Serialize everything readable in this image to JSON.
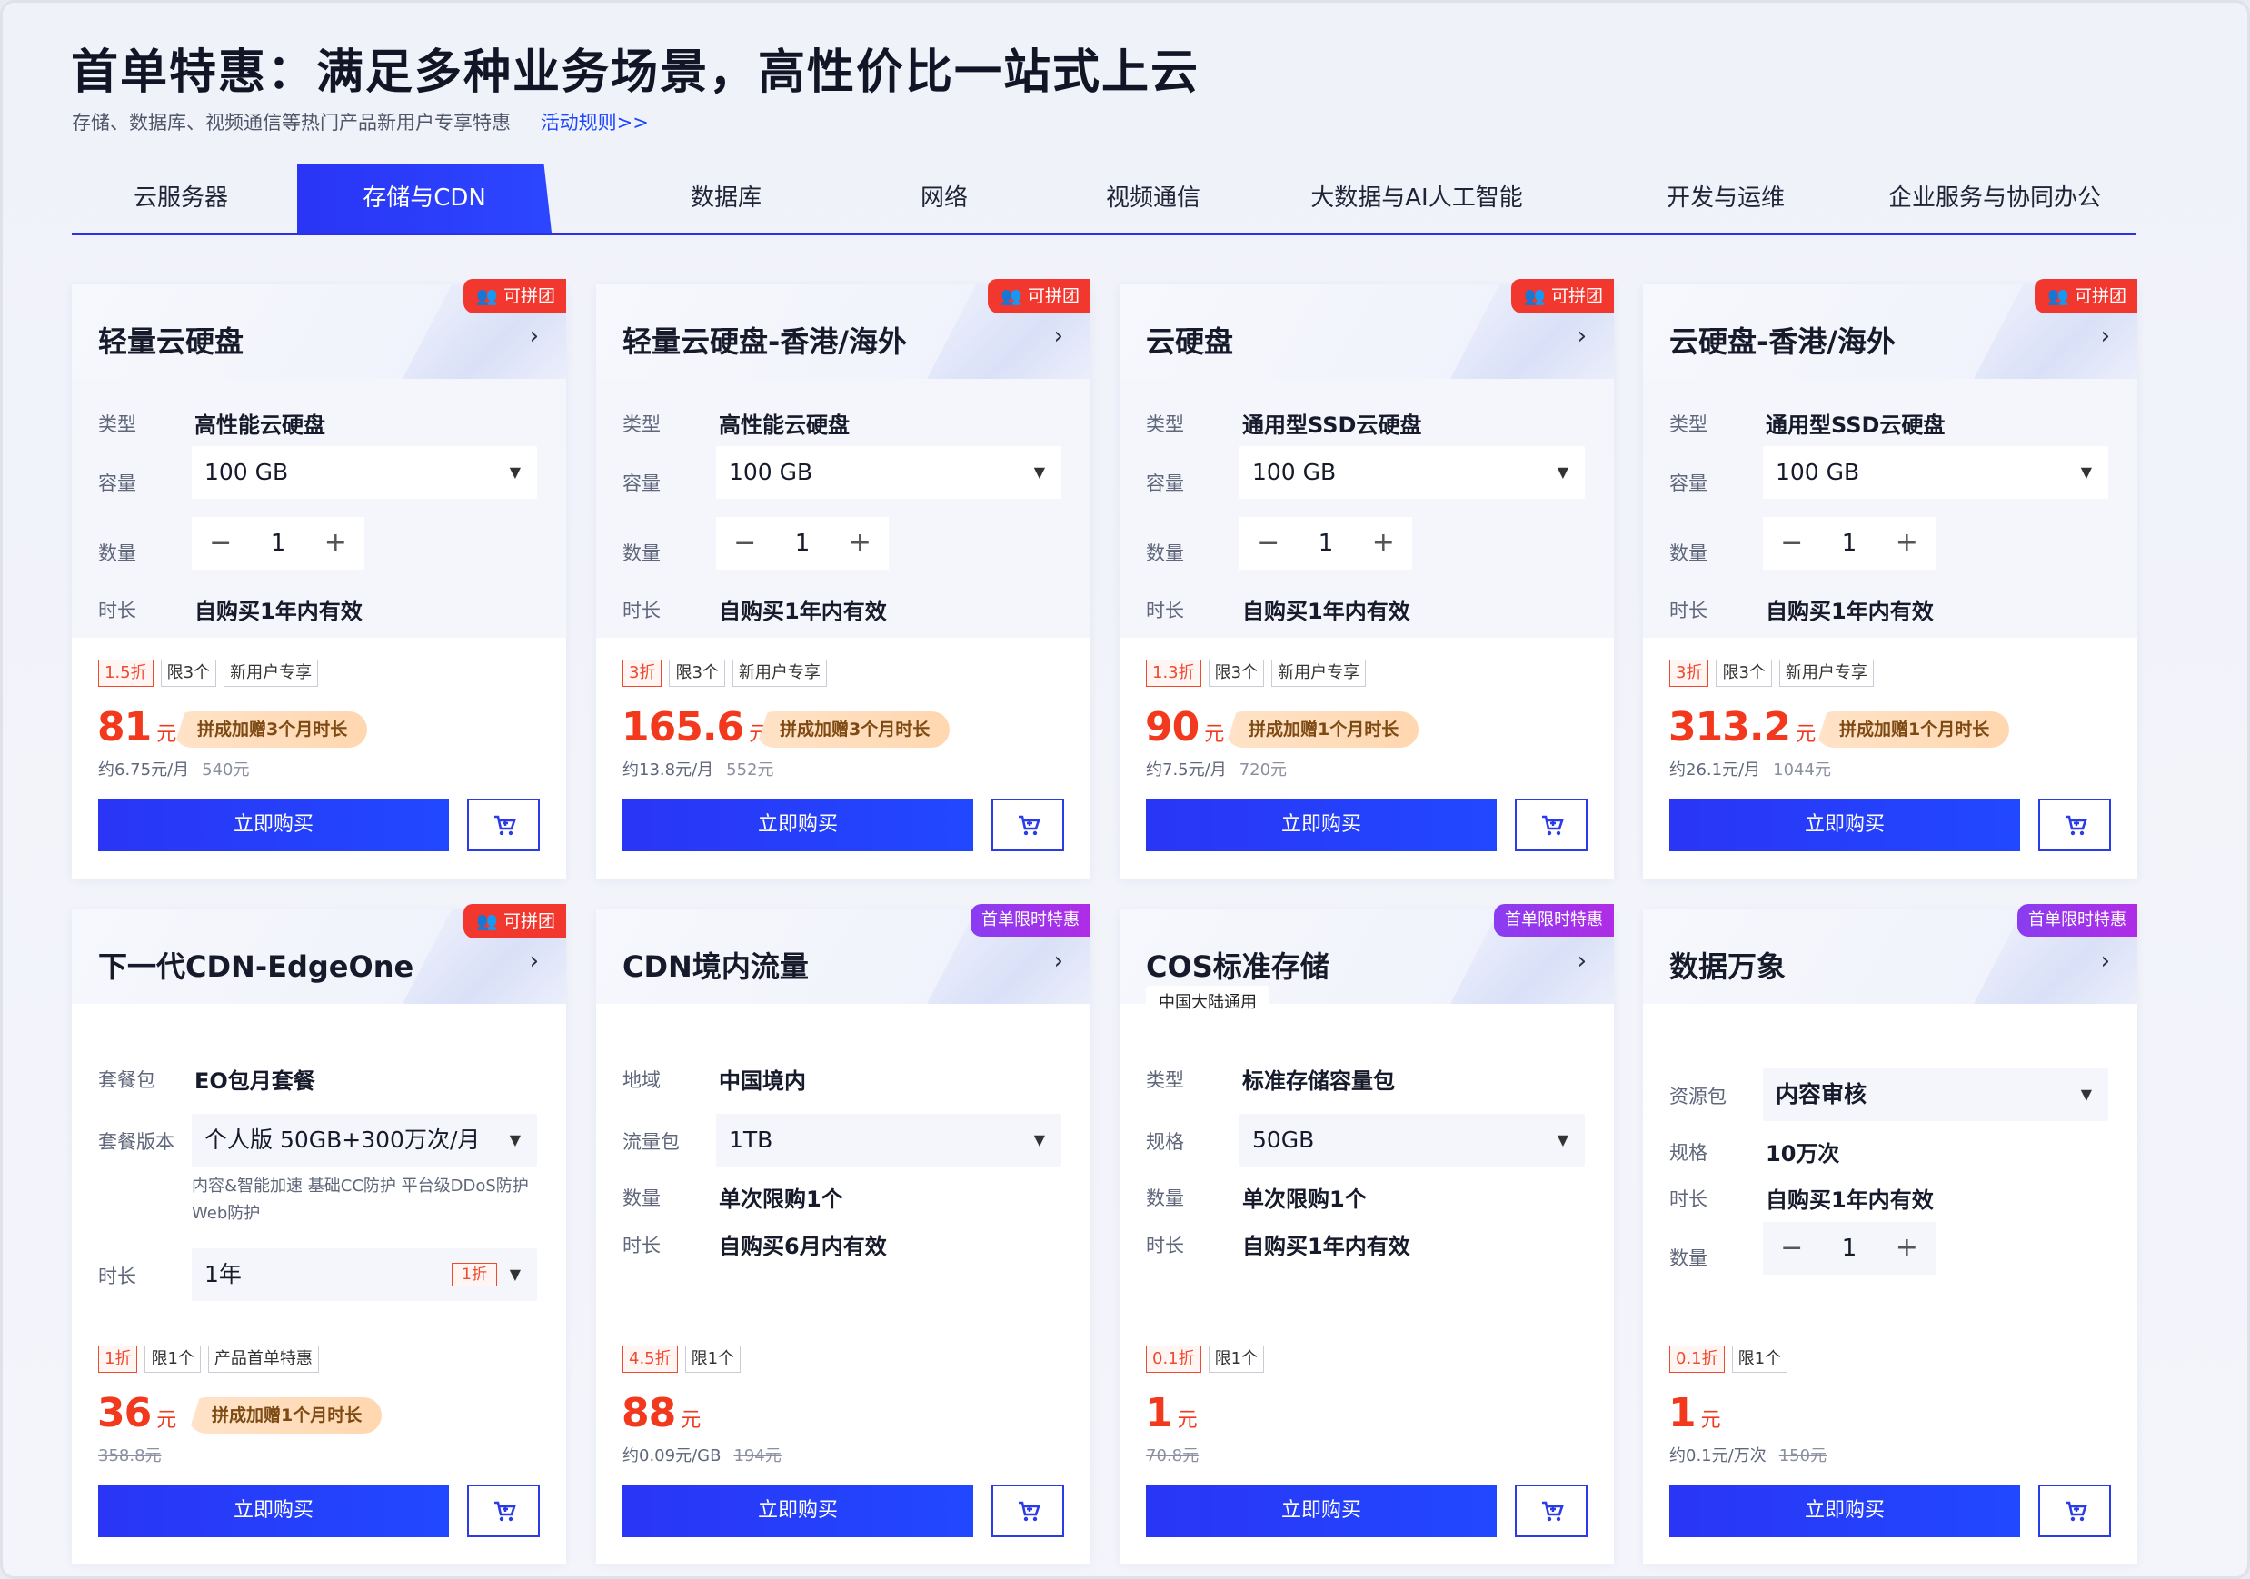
{
  "header": {
    "title": "首单特惠：满足多种业务场景，高性价比一站式上云",
    "subtitle": "存储、数据库、视频通信等热门产品新用户专享特惠",
    "rule_link": "活动规则>>"
  },
  "tabs": [
    {
      "label": "云服务器"
    },
    {
      "label": "存储与CDN",
      "active": true
    },
    {
      "label": "数据库"
    },
    {
      "label": "网络"
    },
    {
      "label": "视频通信"
    },
    {
      "label": "大数据与AI人工智能"
    },
    {
      "label": "开发与运维"
    },
    {
      "label": "企业服务与协同办公"
    }
  ],
  "common": {
    "buy_label": "立即购买",
    "chevron": "›",
    "minus": "−",
    "plus": "+",
    "caret": "▼",
    "group_badge": "可拼团",
    "first_badge": "首单限时特惠",
    "yuan": "元",
    "icons": {
      "cart": "cart-icon",
      "people": "group-icon",
      "chevron": "chevron-right-icon",
      "caret": "caret-down-icon"
    }
  },
  "cards": [
    {
      "name": "轻量云硬盘",
      "badge": "可拼团",
      "specs": {
        "type_label": "类型",
        "type_value": "高性能云硬盘",
        "cap_label": "容量",
        "cap_value": "100 GB",
        "qty_label": "数量",
        "qty_value": "1",
        "dur_label": "时长",
        "dur_value": "自购买1年内有效"
      },
      "tags": [
        "1.5折",
        "限3个",
        "新用户专享"
      ],
      "price": "81",
      "promo": "拼成加赠3个月时长",
      "per": "约6.75元/月",
      "orig": "540元"
    },
    {
      "name": "轻量云硬盘-香港/海外",
      "badge": "可拼团",
      "specs": {
        "type_label": "类型",
        "type_value": "高性能云硬盘",
        "cap_label": "容量",
        "cap_value": "100 GB",
        "qty_label": "数量",
        "qty_value": "1",
        "dur_label": "时长",
        "dur_value": "自购买1年内有效"
      },
      "tags": [
        "3折",
        "限3个",
        "新用户专享"
      ],
      "price": "165.6",
      "promo": "拼成加赠3个月时长",
      "per": "约13.8元/月",
      "orig": "552元"
    },
    {
      "name": "云硬盘",
      "badge": "可拼团",
      "specs": {
        "type_label": "类型",
        "type_value": "通用型SSD云硬盘",
        "cap_label": "容量",
        "cap_value": "100 GB",
        "qty_label": "数量",
        "qty_value": "1",
        "dur_label": "时长",
        "dur_value": "自购买1年内有效"
      },
      "tags": [
        "1.3折",
        "限3个",
        "新用户专享"
      ],
      "price": "90",
      "promo": "拼成加赠1个月时长",
      "per": "约7.5元/月",
      "orig": "720元"
    },
    {
      "name": "云硬盘-香港/海外",
      "badge": "可拼团",
      "specs": {
        "type_label": "类型",
        "type_value": "通用型SSD云硬盘",
        "cap_label": "容量",
        "cap_value": "100 GB",
        "qty_label": "数量",
        "qty_value": "1",
        "dur_label": "时长",
        "dur_value": "自购买1年内有效"
      },
      "tags": [
        "3折",
        "限3个",
        "新用户专享"
      ],
      "price": "313.2",
      "promo": "拼成加赠1个月时长",
      "per": "约26.1元/月",
      "orig": "1044元"
    },
    {
      "name": "下一代CDN-EdgeOne",
      "badge": "可拼团",
      "specs": {
        "pkg_label": "套餐包",
        "pkg_value": "EO包月套餐",
        "ver_label": "套餐版本",
        "ver_value": "个人版 50GB+300万次/月",
        "note": "内容&智能加速 基础CC防护 平台级DDoS防护 Web防护",
        "dur_label": "时长",
        "dur_value": "1年",
        "dur_disc": "1折"
      },
      "tags": [
        "1折",
        "限1个",
        "产品首单特惠"
      ],
      "price": "36",
      "promo": "拼成加赠1个月时长",
      "orig": "358.8元"
    },
    {
      "name": "CDN境内流量",
      "badge": "首单限时特惠",
      "specs": {
        "region_label": "地域",
        "region_value": "中国境内",
        "pack_label": "流量包",
        "pack_value": "1TB",
        "qty_label": "数量",
        "qty_value": "单次限购1个",
        "dur_label": "时长",
        "dur_value": "自购买6月内有效"
      },
      "tags": [
        "4.5折",
        "限1个"
      ],
      "price": "88",
      "per": "约0.09元/GB",
      "orig": "194元"
    },
    {
      "name": "COS标准存储",
      "badge": "首单限时特惠",
      "region_tag": "中国大陆通用",
      "specs": {
        "type_label": "类型",
        "type_value": "标准存储容量包",
        "size_label": "规格",
        "size_value": "50GB",
        "qty_label": "数量",
        "qty_value": "单次限购1个",
        "dur_label": "时长",
        "dur_value": "自购买1年内有效"
      },
      "tags": [
        "0.1折",
        "限1个"
      ],
      "price": "1",
      "orig": "70.8元"
    },
    {
      "name": "数据万象",
      "badge": "首单限时特惠",
      "specs": {
        "res_label": "资源包",
        "res_value": "内容审核",
        "size_label": "规格",
        "size_value": "10万次",
        "dur_label": "时长",
        "dur_value": "自购买1年内有效",
        "qty_label": "数量",
        "qty_value": "1"
      },
      "tags": [
        "0.1折",
        "限1个"
      ],
      "price": "1",
      "per": "约0.1元/万次",
      "orig": "150元"
    }
  ],
  "colors": {
    "accent": "#2a35f5",
    "price": "#f2381d",
    "group_badge": "#f2372f",
    "first_badge": "#9b35ea"
  }
}
